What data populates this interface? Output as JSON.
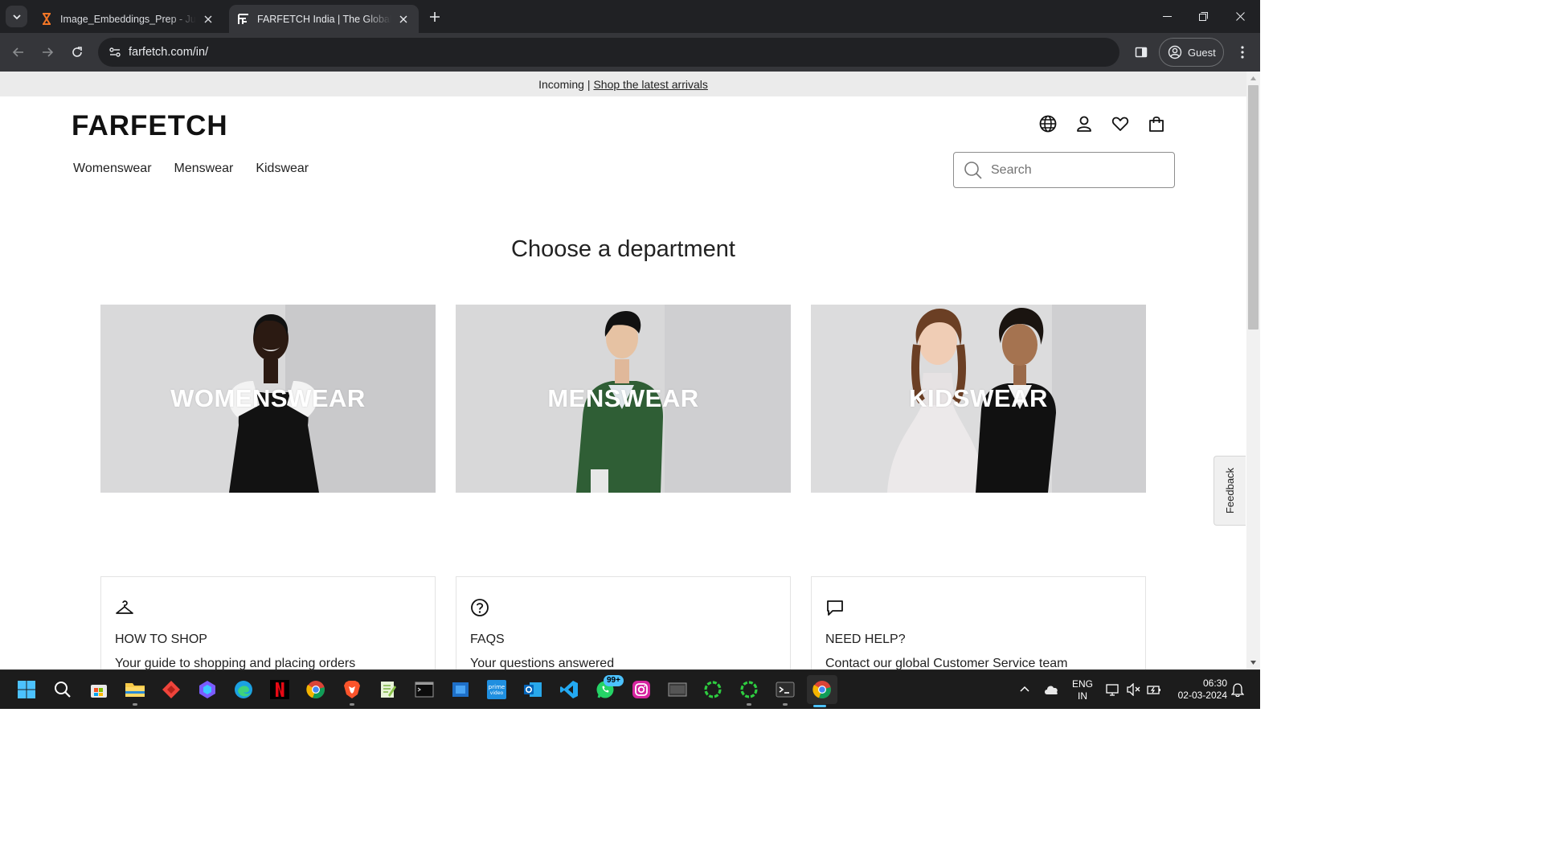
{
  "browser": {
    "tabs": [
      {
        "title": "Image_Embeddings_Prep - Jupyter",
        "active": false
      },
      {
        "title": "FARFETCH India | The Global Destination",
        "active": true
      }
    ],
    "url": "farfetch.com/in/",
    "profile_label": "Guest"
  },
  "page": {
    "announcement": {
      "prefix": "Incoming |",
      "link": "Shop the latest arrivals"
    },
    "logo": "FARFETCH",
    "header_icons": [
      "globe-icon",
      "account-icon",
      "wishlist-heart-icon",
      "shopping-bag-icon"
    ],
    "nav": [
      "Womenswear",
      "Menswear",
      "Kidswear"
    ],
    "search": {
      "placeholder": "Search",
      "value": ""
    },
    "heading": "Choose a department",
    "departments": [
      {
        "label": "WOMENSWEAR"
      },
      {
        "label": "MENSWEAR"
      },
      {
        "label": "KIDSWEAR"
      }
    ],
    "info_cards": [
      {
        "icon": "hanger-icon",
        "title": "HOW TO SHOP",
        "desc": "Your guide to shopping and placing orders"
      },
      {
        "icon": "question-circle-icon",
        "title": "FAQS",
        "desc": "Your questions answered"
      },
      {
        "icon": "chat-bubble-icon",
        "title": "NEED HELP?",
        "desc": "Contact our global Customer Service team"
      }
    ],
    "feedback_label": "Feedback"
  },
  "taskbar": {
    "apps": [
      "start",
      "search",
      "microsoft-store",
      "file-explorer",
      "anydesk",
      "bing-copilot",
      "edge",
      "netflix",
      "chrome",
      "brave",
      "notepad-plus",
      "terminal-cmd",
      "windows-sandbox",
      "prime-video",
      "outlook",
      "vscode",
      "whatsapp",
      "instagram",
      "virtual-machine",
      "spotify-like-1",
      "spotify-like-2",
      "terminal",
      "chrome-active"
    ],
    "whatsapp_badge": "99+",
    "language": {
      "line1": "ENG",
      "line2": "IN"
    },
    "time": "06:30",
    "date": "02-03-2024"
  },
  "colors": {
    "chrome_dark": "#202124",
    "chrome_toolbar": "#35363a",
    "announcement_bg": "#ebebeb",
    "accent": "#4cc2ff"
  }
}
